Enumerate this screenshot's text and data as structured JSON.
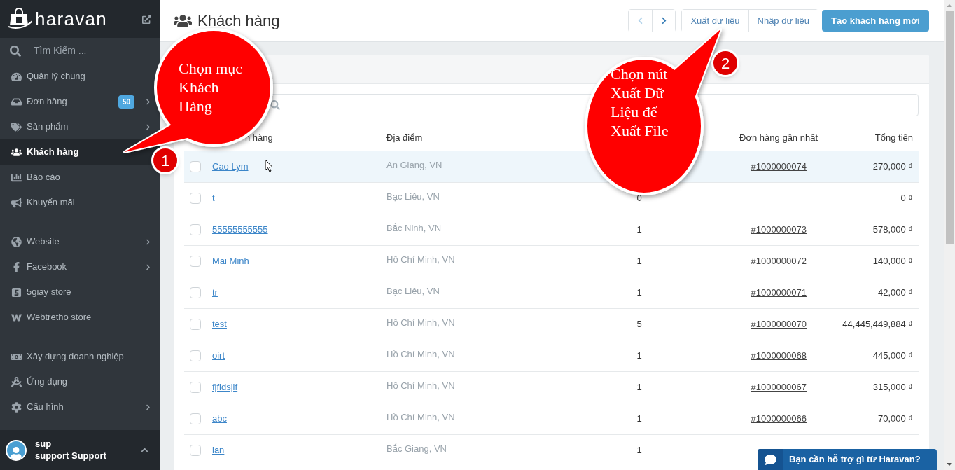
{
  "sidebar": {
    "brand": "haravan",
    "search": {
      "placeholder": "Tìm Kiếm ..."
    },
    "groups": [
      [
        {
          "label": "Quản lý chung",
          "selected": false,
          "expandable": false
        },
        {
          "label": "Đơn hàng",
          "selected": false,
          "expandable": true,
          "badge": "50"
        },
        {
          "label": "Sản phẩm",
          "selected": false,
          "expandable": true
        },
        {
          "label": "Khách hàng",
          "selected": true,
          "expandable": false
        },
        {
          "label": "Báo cáo",
          "selected": false,
          "expandable": false
        },
        {
          "label": "Khuyến mãi",
          "selected": false,
          "expandable": false
        }
      ],
      [
        {
          "label": "Website",
          "selected": false,
          "expandable": true
        },
        {
          "label": "Facebook",
          "selected": false,
          "expandable": true
        },
        {
          "label": "5giay store",
          "selected": false,
          "expandable": false
        },
        {
          "label": "Webtretho store",
          "selected": false,
          "expandable": false
        }
      ],
      [
        {
          "label": "Xây dựng doanh nghiệp",
          "selected": false,
          "expandable": false
        },
        {
          "label": "Ứng dụng",
          "selected": false,
          "expandable": false
        },
        {
          "label": "Cấu hình",
          "selected": false,
          "expandable": true
        }
      ]
    ],
    "user": {
      "name": "sup",
      "full_name": "support Support"
    }
  },
  "header": {
    "title": "Khách hàng",
    "pager": [
      {
        "disabled": true
      },
      {
        "disabled": false
      }
    ],
    "actions": [
      "Xuất dữ liệu",
      "Nhập dữ liệu"
    ],
    "primary": "Tạo khách hàng mới"
  },
  "table": {
    "columns": [
      "n hàng",
      "Địa điểm",
      "",
      "Đơn hàng gần nhất",
      "Tổng tiền"
    ],
    "rows": [
      {
        "name": "Cao Lym",
        "location": "An Giang, VN",
        "orders": "",
        "last_order": "#1000000074",
        "total": "270,000 ₫",
        "selected": true
      },
      {
        "name": "t",
        "location": "Bạc Liêu, VN",
        "orders": "0",
        "last_order": "",
        "total": "0 ₫",
        "selected": false
      },
      {
        "name": "55555555555",
        "location": "Bắc Ninh, VN",
        "orders": "1",
        "last_order": "#1000000073",
        "total": "578,000 ₫",
        "selected": false
      },
      {
        "name": "Mai Minh",
        "location": "Hồ Chí Minh, VN",
        "orders": "1",
        "last_order": "#1000000072",
        "total": "140,000 ₫",
        "selected": false
      },
      {
        "name": "tr",
        "location": "Bạc Liêu, VN",
        "orders": "1",
        "last_order": "#1000000071",
        "total": "42,000 ₫",
        "selected": false
      },
      {
        "name": "test",
        "location": "Hồ Chí Minh, VN",
        "orders": "5",
        "last_order": "#1000000070",
        "total": "44,445,449,884 ₫",
        "selected": false
      },
      {
        "name": "oirt",
        "location": "Hồ Chí Minh, VN",
        "orders": "1",
        "last_order": "#1000000068",
        "total": "445,000 ₫",
        "selected": false
      },
      {
        "name": "fjfldsjlf",
        "location": "Hồ Chí Minh, VN",
        "orders": "1",
        "last_order": "#1000000067",
        "total": "315,000 ₫",
        "selected": false
      },
      {
        "name": "abc",
        "location": "Hồ Chí Minh, VN",
        "orders": "1",
        "last_order": "#1000000066",
        "total": "70,000 ₫",
        "selected": false
      },
      {
        "name": "lan",
        "location": "Bắc Giang, VN",
        "orders": "1",
        "last_order": "",
        "total": "",
        "selected": false
      }
    ]
  },
  "annotations": [
    {
      "number": "1",
      "text": "Chọn mục Khách Hàng"
    },
    {
      "number": "2",
      "text": "Chọn nút Xuất Dữ Liệu để Xuất File"
    }
  ],
  "chat": {
    "label": "Bạn cần hỗ trợ gì từ Haravan?"
  }
}
